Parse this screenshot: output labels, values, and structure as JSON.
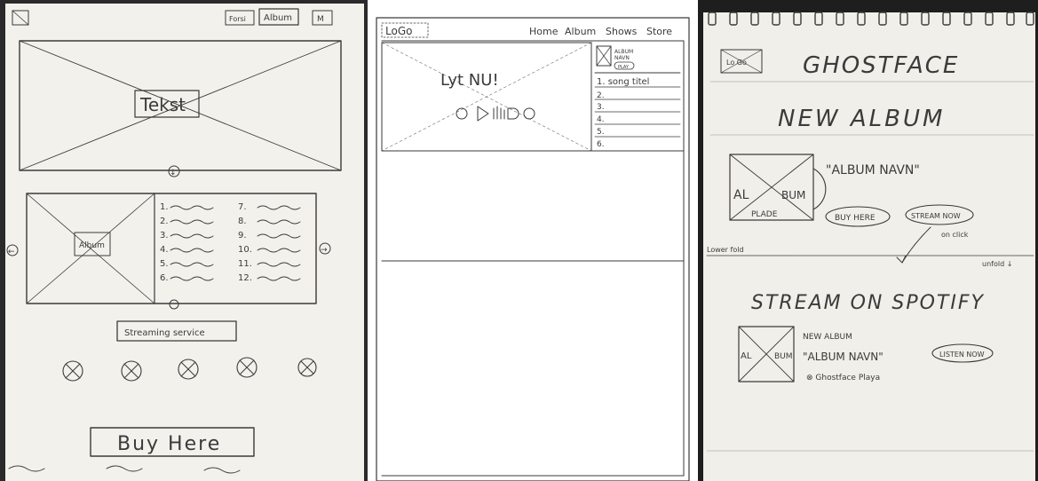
{
  "sketch1": {
    "nav": [
      "Forsi",
      "Album",
      "M"
    ],
    "hero_text": "Tekst",
    "album_label": "Album",
    "tracks_left": [
      "1.",
      "2.",
      "3.",
      "4.",
      "5.",
      "6."
    ],
    "tracks_right": [
      "7.",
      "8.",
      "9.",
      "10.",
      "11.",
      "12."
    ],
    "streaming_label": "Streaming service",
    "buy_label": "Buy Here",
    "arrow_down": "↓",
    "arrow_left": "←",
    "arrow_right": "→"
  },
  "sketch2": {
    "logo": "LoGo",
    "nav": [
      "Home",
      "Album",
      "Shows",
      "Store"
    ],
    "hero_text": "Lyt NU!",
    "album_caption": "ALBUM",
    "album_sub": "NAVN",
    "play_label": "PLAY",
    "tracks": [
      "1. song titel",
      "2.",
      "3.",
      "4.",
      "5.",
      "6."
    ]
  },
  "sketch3": {
    "logo": "Lo Go",
    "title": "GHOSTFACE",
    "new_album": "NEW ALBUM",
    "album_name": "\"ALBUM NAVN\"",
    "cover_left": "AL",
    "cover_right": "BUM",
    "plade": "PLADE",
    "buy_here": "BUY HERE",
    "stream_now": "STREAM NOW",
    "on_click": "on click",
    "lower_fold": "Lower fold",
    "unfold": "unfold ↓",
    "stream_on": "STREAM ON SPOTIFY",
    "np_new_album": "NEW ALBUM",
    "np_album_name": "\"ALBUM NAVN\"",
    "np_artist": "⊗ Ghostface Playa",
    "listen_now": "LISTEN NOW"
  }
}
